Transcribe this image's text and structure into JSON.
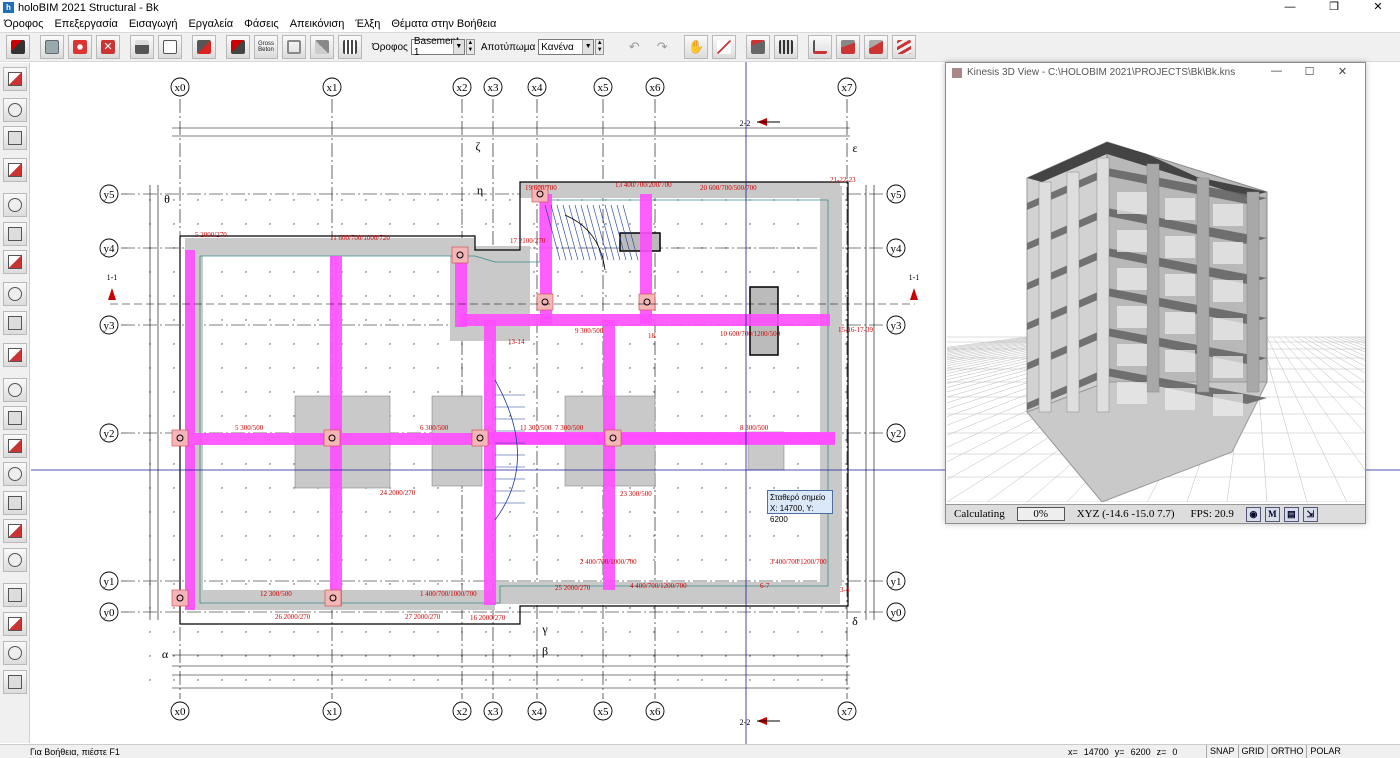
{
  "window": {
    "title": "holoBIM 2021 Structural - Bk",
    "icon_name": "holobim-app-icon",
    "controls": [
      "minimize-icon",
      "maximize-icon",
      "close-icon"
    ]
  },
  "menu": [
    "Όροφος",
    "Επεξεργασία",
    "Εισαγωγή",
    "Εργαλεία",
    "Φάσεις",
    "Απεικόνιση",
    "Έλξη",
    "Θέματα στην Βοήθεια"
  ],
  "toolbar": {
    "floor_label": "Όροφος",
    "floor_value": "Basement 1",
    "display_label": "Αποτύπωμα",
    "display_value": "Κανένα",
    "gross_button_label": "Gross Beton"
  },
  "grid_axes": {
    "x": [
      "x0",
      "x1",
      "x2",
      "x3",
      "x4",
      "x5",
      "x6",
      "x7"
    ],
    "y": [
      "y5",
      "y4",
      "y3",
      "y2",
      "y1",
      "y0"
    ]
  },
  "section_marks": {
    "top": "2-2",
    "bottom": "2-2",
    "left": "1-1",
    "right": "1-1"
  },
  "zone_letters": [
    "ζ",
    "ε",
    "η",
    "θ",
    "α",
    "β",
    "γ",
    "δ"
  ],
  "beam_labels": [
    "11 600/700/1000/720",
    "17 2100/270",
    "13 400/700/200/700",
    "20 600/700/500/700",
    "19 600/700",
    "21-22-23",
    "9 300/500",
    "10 600/700/1200/500",
    "18",
    "5 300/500",
    "6 300/500",
    "7 300/500",
    "8 300/500",
    "11 300/500",
    "12 300/500",
    "1 400/700/1000/700",
    "2 400/700/1000/700",
    "3 400/700/1200/700",
    "4 400/700/1200/700",
    "5 2000/270",
    "13-14",
    "15-16-17-39",
    "23 300/500",
    "24 2000/270",
    "25 2000/270",
    "26 2000/270",
    "27 2000/270",
    "6-7",
    "3-4",
    "16 2000/270"
  ],
  "tooltip": {
    "line1": "Σταθερό σημείο",
    "line2": "X: 14700, Y: 6200"
  },
  "view3d": {
    "title": "Kinesis 3D View - C:\\HOLOBIM 2021\\PROJECTS\\Bk\\Bk.kns",
    "status": "Calculating",
    "progress": "0%",
    "xyz": "XYZ (-14.6 -15.0 7.7)",
    "fps": "FPS: 20.9",
    "buttons": [
      "camera-icon",
      "M",
      "print-icon",
      "export-icon"
    ]
  },
  "statusbar": {
    "help": "Για Βοήθεια, πιέστε F1",
    "x_label": "x=",
    "x": "14700",
    "y_label": "y=",
    "y": "6200",
    "z_label": "z=",
    "z": "0",
    "modes": [
      "SNAP",
      "GRID",
      "ORTHO",
      "POLAR"
    ]
  },
  "colors": {
    "beam": "#ff5cff",
    "slab": "#c8c8c8",
    "dims": "#000000",
    "labels_red": "#d40000",
    "cursor": "#1a1a9a"
  }
}
